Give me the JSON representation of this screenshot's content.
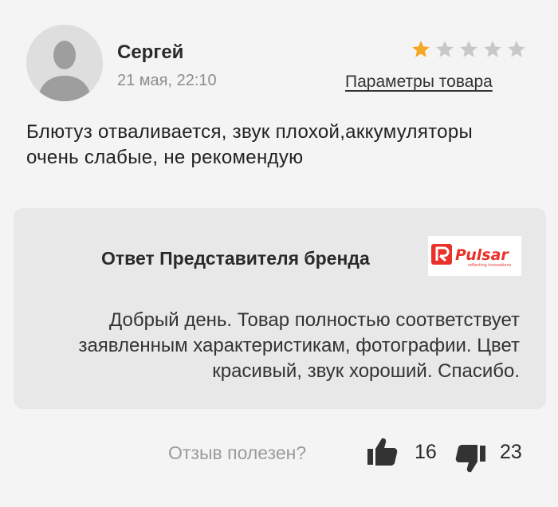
{
  "review": {
    "author": "Сергей",
    "date": "21 мая, 22:10",
    "rating": 1,
    "max_rating": 5,
    "product_params_link": "Параметры товара",
    "text": "Блютуз отваливается, звук плохой,аккумуляторы очень слабые, не рекомендую"
  },
  "brand_reply": {
    "title": "Ответ Представителя бренда",
    "logo_text": "Pulsar",
    "logo_tagline": "reflecting innovations",
    "text": "Добрый день. Товар полностью соответствует заявленным характеристикам, фотографии. Цвет красивый, звук хороший. Спасибо."
  },
  "helpful": {
    "label": "Отзыв полезен?",
    "likes": "16",
    "dislikes": "23"
  },
  "colors": {
    "star_filled": "#f5a623",
    "star_empty": "#c8c8c8",
    "brand_red": "#e8322a"
  },
  "icons": {
    "avatar": "user-placeholder-icon",
    "like": "thumb-up-icon",
    "dislike": "thumb-down-icon",
    "star": "star-icon"
  }
}
